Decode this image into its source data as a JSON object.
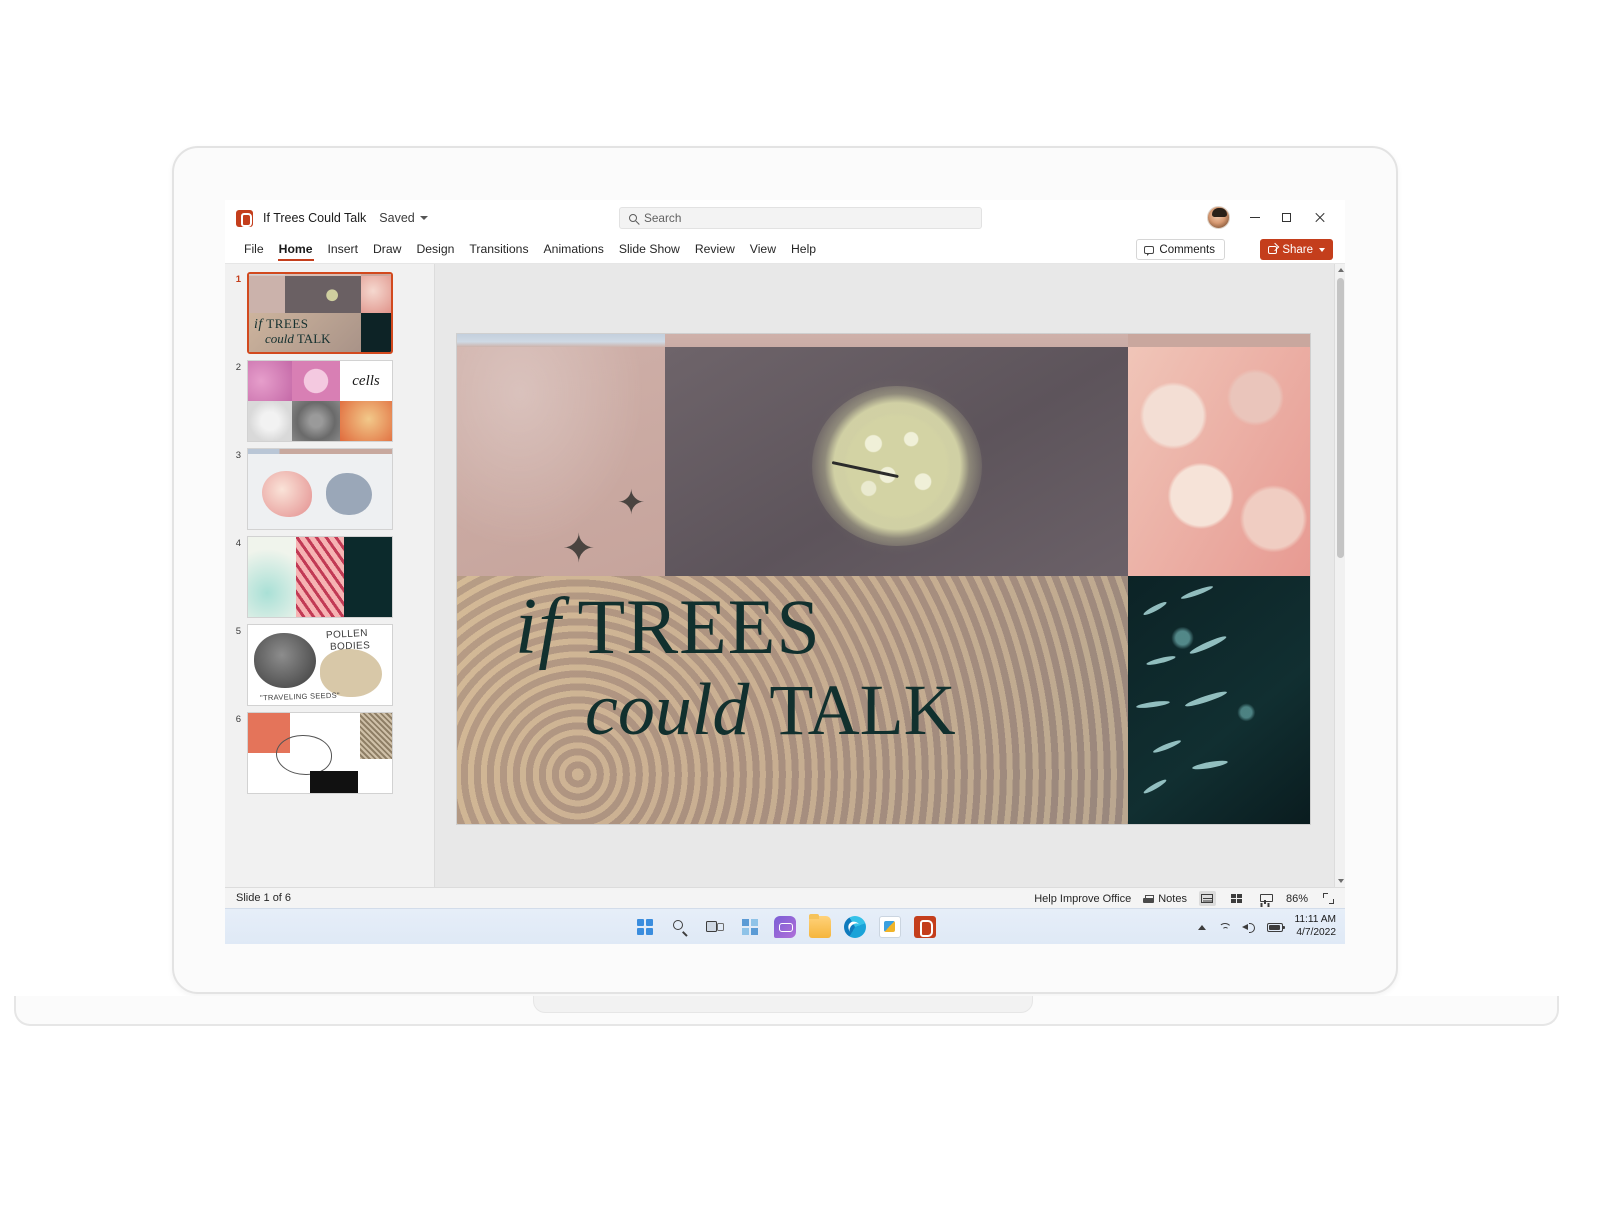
{
  "app": {
    "logo_icon": "powerpoint-logo-icon",
    "doc_title": "If Trees Could Talk",
    "save_state": "Saved",
    "accent_color": "#c43e1c"
  },
  "search": {
    "icon": "search-icon",
    "placeholder": "Search",
    "value": "Search"
  },
  "window_controls": {
    "minimize": "minimize-icon",
    "maximize": "maximize-icon",
    "close": "close-icon"
  },
  "ribbon": {
    "tabs": [
      {
        "label": "File",
        "active": false
      },
      {
        "label": "Home",
        "active": true
      },
      {
        "label": "Insert",
        "active": false
      },
      {
        "label": "Draw",
        "active": false
      },
      {
        "label": "Design",
        "active": false
      },
      {
        "label": "Transitions",
        "active": false
      },
      {
        "label": "Animations",
        "active": false
      },
      {
        "label": "Slide Show",
        "active": false
      },
      {
        "label": "Review",
        "active": false
      },
      {
        "label": "View",
        "active": false
      },
      {
        "label": "Help",
        "active": false
      }
    ],
    "comments_label": "Comments",
    "share_label": "Share"
  },
  "thumbnails": [
    {
      "number": "1",
      "selected": true,
      "title": "if TREES could TALK"
    },
    {
      "number": "2",
      "selected": false,
      "title": "cells"
    },
    {
      "number": "3",
      "selected": false,
      "title": ""
    },
    {
      "number": "4",
      "selected": false,
      "title": ""
    },
    {
      "number": "5",
      "selected": false,
      "line1": "POLLEN",
      "line2": "BODIES",
      "line3": "\"TRAVELING SEEDS\""
    },
    {
      "number": "6",
      "selected": false,
      "title": ""
    }
  ],
  "slide": {
    "headline_italic_1": "if",
    "headline_roman_1": "TREES",
    "headline_italic_2": "could",
    "headline_roman_2": "TALK"
  },
  "status_bar": {
    "slide_count": "Slide 1 of 6",
    "help_improve": "Help Improve Office",
    "notes_label": "Notes",
    "notes_icon": "notes-icon",
    "view_normal": "normal-view-icon",
    "view_sorter": "slide-sorter-icon",
    "view_reading": "reading-view-icon",
    "zoom_level": "86%",
    "fit_icon": "fit-slide-icon"
  },
  "taskbar": {
    "icons": [
      "start-icon",
      "search-icon",
      "task-view-icon",
      "widgets-icon",
      "chat-icon",
      "file-explorer-icon",
      "edge-icon",
      "store-icon",
      "powerpoint-icon"
    ],
    "tray": {
      "chevron": "show-hidden-icons-icon",
      "wifi": "wifi-icon",
      "volume": "volume-icon",
      "battery": "battery-icon"
    },
    "time": "11:11 AM",
    "date": "4/7/2022"
  }
}
